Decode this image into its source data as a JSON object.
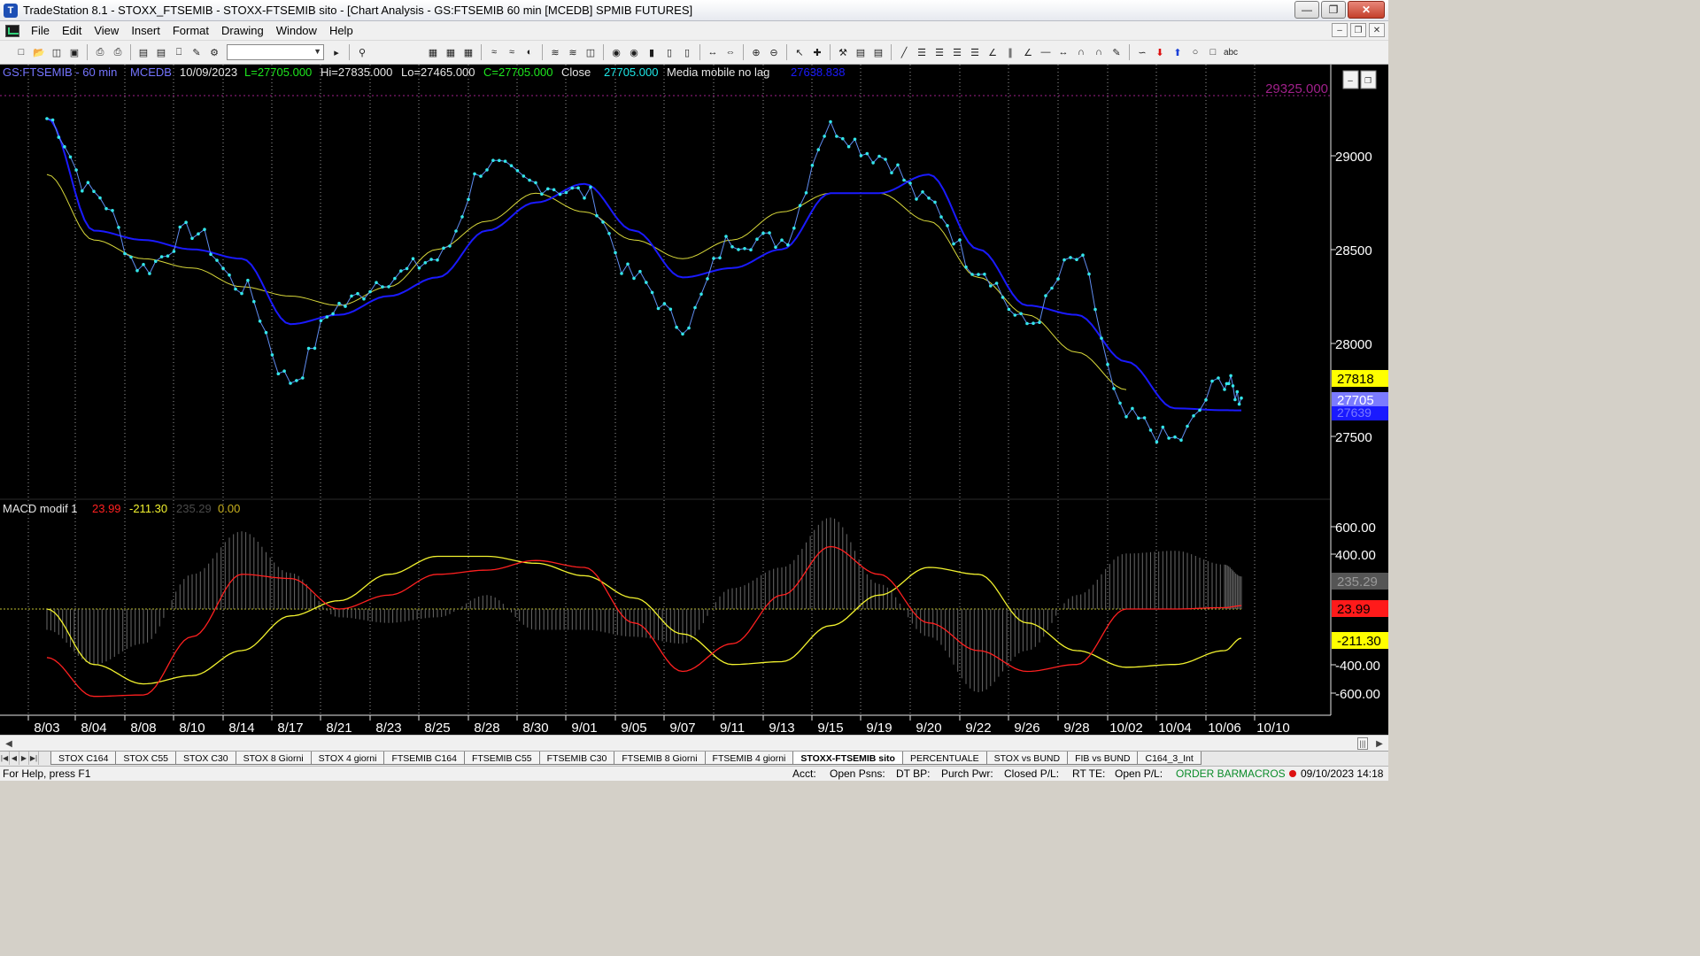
{
  "window": {
    "title": "TradeStation 8.1 - STOXX_FTSEMIB - STOXX-FTSEMIB sito - [Chart Analysis - GS:FTSEMIB  60 min  [MCEDB] SPMIB FUTURES]",
    "app_icon": "tradestation-icon"
  },
  "menu": [
    "File",
    "Edit",
    "View",
    "Insert",
    "Format",
    "Drawing",
    "Window",
    "Help"
  ],
  "price_header": {
    "symbol": "GS:FTSEMIB - 60 min",
    "exchange": "MCEDB",
    "date": "10/09/2023",
    "last": "L=27705.000",
    "high": "Hi=27835.000",
    "low": "Lo=27465.000",
    "close": "C=27705.000",
    "close_label": "Close",
    "close_value": "27705.000",
    "indicator_name": "Media mobile no lag",
    "indicator_value": "27638.838",
    "hline_label": "29325.000"
  },
  "macd_header": {
    "name": "MACD modif 1",
    "v1": "23.99",
    "v2": "-211.30",
    "v3": "235.29",
    "v4": "0.00"
  },
  "price_axis": {
    "ticks": [
      "29000",
      "28500",
      "28000",
      "27500"
    ]
  },
  "price_markers": {
    "m1": "27818",
    "m2": "27705",
    "m3": "27639"
  },
  "macd_axis": {
    "ticks": [
      "600.00",
      "400.00",
      "-400.00",
      "-600.00"
    ]
  },
  "macd_markers": {
    "m1": "235.29",
    "m2": "23.99",
    "m3": "-211.30"
  },
  "date_axis": [
    "8/03",
    "8/04",
    "8/08",
    "8/10",
    "8/14",
    "8/17",
    "8/21",
    "8/23",
    "8/25",
    "8/28",
    "8/30",
    "9/01",
    "9/05",
    "9/07",
    "9/11",
    "9/13",
    "9/15",
    "9/19",
    "9/20",
    "9/22",
    "9/26",
    "9/28",
    "10/02",
    "10/04",
    "10/06",
    "10/10"
  ],
  "tabs": [
    "STOX C164",
    "STOX C55",
    "STOX  C30",
    "STOX  8 Giorni",
    "STOX 4 giorni",
    "FTSEMIB C164",
    "FTSEMIB C55",
    "FTSEMIB C30",
    "FTSEMIB  8 Giorni",
    "FTSEMIB  4 giorni",
    "STOXX-FTSEMIB sito",
    "PERCENTUALE",
    "STOX vs BUND",
    "FIB vs BUND",
    "C164_3_Int"
  ],
  "active_tab": "STOXX-FTSEMIB sito",
  "status": {
    "help": "For Help, press F1",
    "acct": "Acct:",
    "open_psns": "Open Psns:",
    "dt_bp": "DT BP:",
    "purch_pwr": "Purch Pwr:",
    "closed_pl": "Closed P/L:",
    "rt_te": "RT TE:",
    "open_pl": "Open P/L:",
    "order_bar": "ORDER BAR",
    "macros": "MACROS",
    "datetime": "09/10/2023 14:18"
  },
  "colors": {
    "price_line": "#5f8cf0",
    "price_dots": "#33e6ea",
    "ma_blue": "#1a1aff",
    "ma_yellow": "#d8d83a",
    "macd_red": "#ff2020",
    "macd_yellow": "#f2f22e",
    "histogram": "#6a6a6a",
    "header_green": "#1ee81e",
    "header_cyan": "#1ee8e8",
    "marker_yellow": "#ffff00",
    "marker_blue": "#7b7bff",
    "marker_darkblue": "#1a1aff",
    "hline_purple": "#a0208a"
  },
  "chart_data": [
    {
      "type": "line",
      "title": "GS:FTSEMIB - 60 min",
      "x": [
        "8/03",
        "8/04",
        "8/08",
        "8/10",
        "8/14",
        "8/17",
        "8/21",
        "8/23",
        "8/25",
        "8/28",
        "8/30",
        "9/01",
        "9/05",
        "9/07",
        "9/11",
        "9/13",
        "9/15",
        "9/19",
        "9/20",
        "9/22",
        "9/26",
        "9/28",
        "10/02",
        "10/04",
        "10/06",
        "10/09"
      ],
      "ylim": [
        27300,
        29400
      ],
      "yticks": [
        27500,
        28000,
        28500,
        29000
      ],
      "hline": 29325,
      "series": [
        {
          "name": "Close",
          "values": [
            29200,
            28800,
            28400,
            28600,
            28300,
            27800,
            28200,
            28350,
            28450,
            28950,
            28850,
            28800,
            28350,
            28100,
            28550,
            28550,
            29150,
            29000,
            28750,
            28400,
            28100,
            28450,
            27600,
            27480,
            27800,
            27705
          ]
        },
        {
          "name": "Media mobile no lag",
          "values": [
            29200,
            28600,
            28550,
            28500,
            28450,
            28100,
            28150,
            28250,
            28350,
            28600,
            28750,
            28850,
            28600,
            28350,
            28400,
            28500,
            28800,
            28800,
            28900,
            28500,
            28200,
            28150,
            27900,
            27650,
            27640,
            27639
          ]
        },
        {
          "name": "",
          "values": [
            28900,
            28550,
            28450,
            28400,
            28300,
            28250,
            28200,
            28300,
            28500,
            28650,
            28800,
            28700,
            28550,
            28450,
            28550,
            28700,
            28800,
            28800,
            28650,
            28350,
            28150,
            27950,
            27750,
            null,
            null,
            null
          ]
        }
      ]
    },
    {
      "type": "line",
      "title": "MACD modif 1",
      "x": [
        "8/03",
        "8/04",
        "8/08",
        "8/10",
        "8/14",
        "8/17",
        "8/21",
        "8/23",
        "8/25",
        "8/28",
        "8/30",
        "9/01",
        "9/05",
        "9/07",
        "9/11",
        "9/13",
        "9/15",
        "9/19",
        "9/20",
        "9/22",
        "9/26",
        "9/28",
        "10/02",
        "10/04",
        "10/06",
        "10/09"
      ],
      "ylim": [
        -750,
        700
      ],
      "yticks": [
        -600,
        -400,
        400,
        600
      ],
      "series": [
        {
          "name": "",
          "values": [
            -350,
            -630,
            -620,
            -200,
            250,
            220,
            0,
            100,
            250,
            280,
            350,
            300,
            -100,
            -450,
            -250,
            100,
            450,
            250,
            -100,
            -300,
            -450,
            -400,
            0,
            0,
            10,
            24
          ]
        },
        {
          "name": "",
          "values": [
            0,
            -400,
            -540,
            -480,
            -300,
            -50,
            60,
            250,
            380,
            380,
            330,
            240,
            80,
            -180,
            -400,
            -380,
            -120,
            100,
            300,
            250,
            -100,
            -300,
            -420,
            -400,
            -300,
            -211
          ]
        },
        {
          "name": "",
          "values": [
            -150,
            -400,
            -250,
            250,
            560,
            260,
            -60,
            -100,
            -60,
            100,
            -150,
            -150,
            -200,
            -250,
            150,
            300,
            660,
            180,
            -200,
            -600,
            -300,
            100,
            400,
            420,
            320,
            235
          ]
        }
      ]
    }
  ]
}
